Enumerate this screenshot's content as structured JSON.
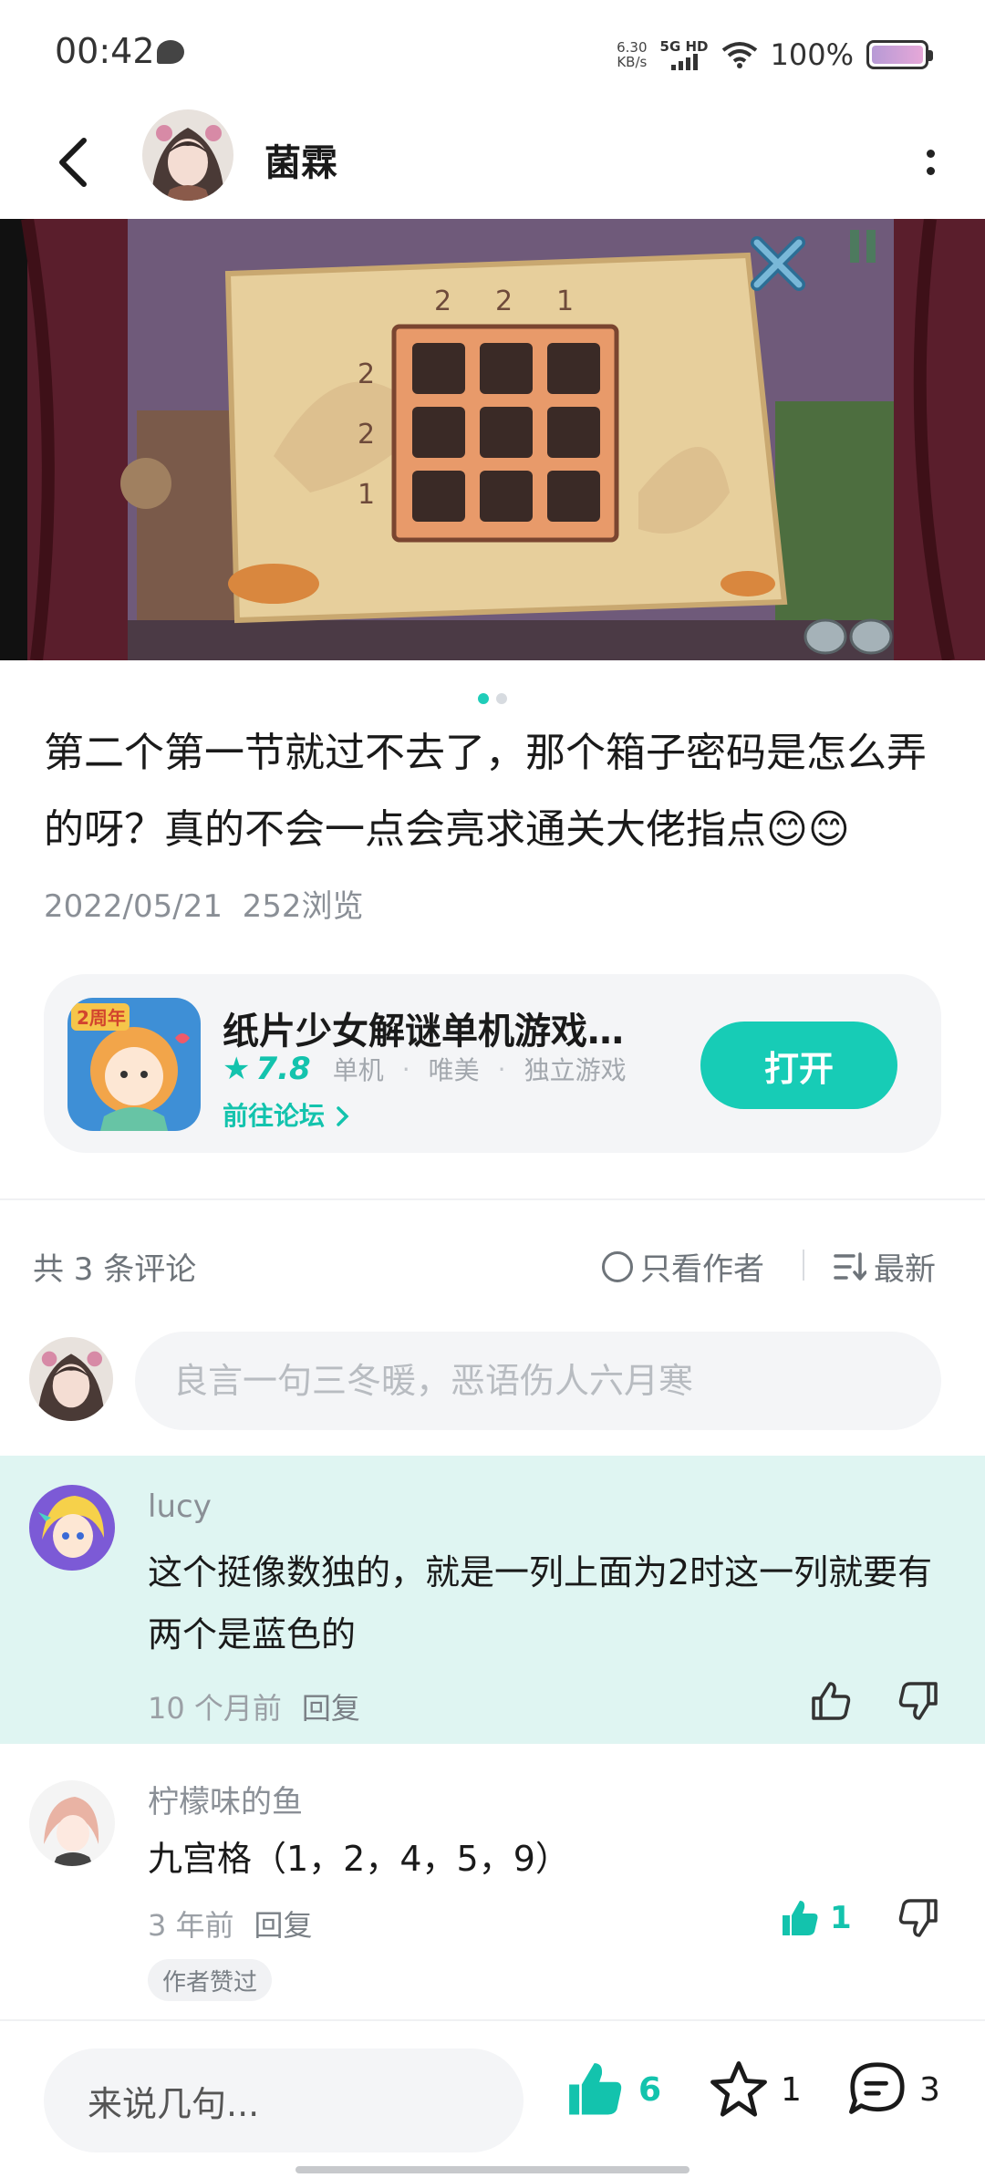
{
  "status_bar": {
    "time": "00:42",
    "net_speed_value": "6.30",
    "net_speed_unit": "KB/s",
    "signal_label": "5G HD",
    "battery": "100%"
  },
  "header": {
    "name": "菌霖"
  },
  "media": {
    "page_count": 2,
    "active_page": 1
  },
  "post": {
    "text": "第二个第一节就过不去了，那个箱子密码是怎么弄的呀？真的不会一点会亮求通关大佬指点😊😊",
    "date": "2022/05/21",
    "views": "252浏览"
  },
  "game_card": {
    "title": "纸片少女解谜单机游戏…",
    "badge": "2周年",
    "rating": "7.8",
    "tags": [
      "单机",
      "唯美",
      "独立游戏"
    ],
    "tag_sep": "·",
    "forum_link": "前往论坛",
    "open_label": "打开"
  },
  "comments_header": {
    "count": "共 3 条评论",
    "author_only": "只看作者",
    "sort": "最新"
  },
  "comment_input": {
    "placeholder": "良言一句三冬暖，恶语伤人六月寒"
  },
  "comments": [
    {
      "name": "lucy",
      "text": "这个挺像数独的，就是一列上面为2时这一列就要有两个是蓝色的",
      "time": "10 个月前",
      "reply": "回复",
      "likes": ""
    },
    {
      "name": "柠檬味的鱼",
      "text": "九宫格（1，2，4，5，9）",
      "time": "3 年前",
      "reply": "回复",
      "likes": "1",
      "badge": "作者赞过"
    }
  ],
  "bottom_bar": {
    "say_placeholder": "来说几句...",
    "likes": "6",
    "favorites": "1",
    "comments": "3"
  },
  "colors": {
    "accent": "#17ccb6",
    "highlight_bg": "#dff5f2"
  }
}
